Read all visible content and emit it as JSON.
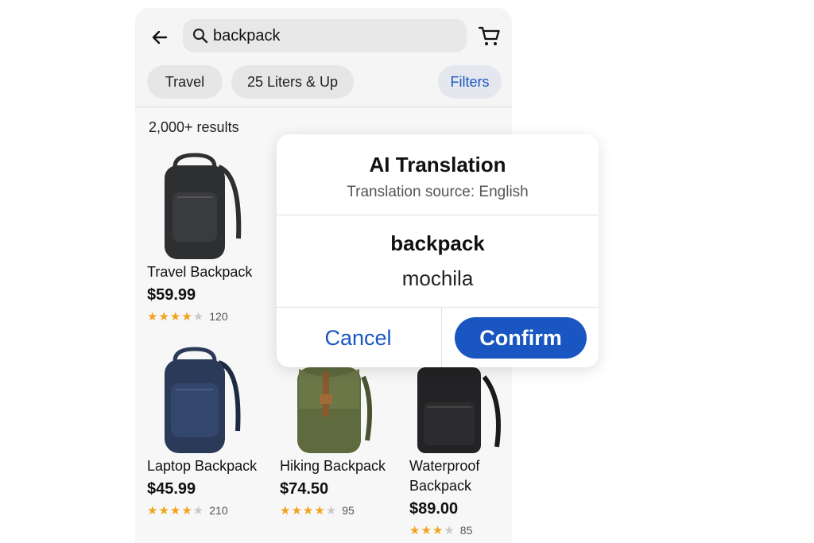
{
  "search": {
    "value": "backpack"
  },
  "chips": {
    "travel": "Travel",
    "liters": "25 Liters & Up",
    "filters": "Filters"
  },
  "results_count": "2,000+ results",
  "colors": {
    "accent": "#1a56c2",
    "star": "#f2a31b"
  },
  "icons": {
    "back": "back-arrow-icon",
    "search": "search-icon",
    "cart": "cart-icon"
  },
  "products": [
    {
      "name": "Travel Backpack",
      "price": "$59.99",
      "rating": 4.5,
      "reviews": "120",
      "color": "#2e2f31"
    },
    {
      "name": "Laptop Backpack",
      "price": "$45.99",
      "rating": 4.5,
      "reviews": "210",
      "color": "#2b3a58"
    },
    {
      "name": "Hiking Backpack",
      "price": "$74.50",
      "rating": 4.5,
      "reviews": "95",
      "color": "#5f6a3e"
    },
    {
      "name": "Waterproof Backpack",
      "price": "$89.00",
      "rating": 3.5,
      "reviews": "85",
      "color": "#232325"
    }
  ],
  "dialog": {
    "title": "AI Translation",
    "subtitle": "Translation source: English",
    "source_word": "backpack",
    "translated_word": "mochila",
    "cancel_label": "Cancel",
    "confirm_label": "Confirm"
  }
}
